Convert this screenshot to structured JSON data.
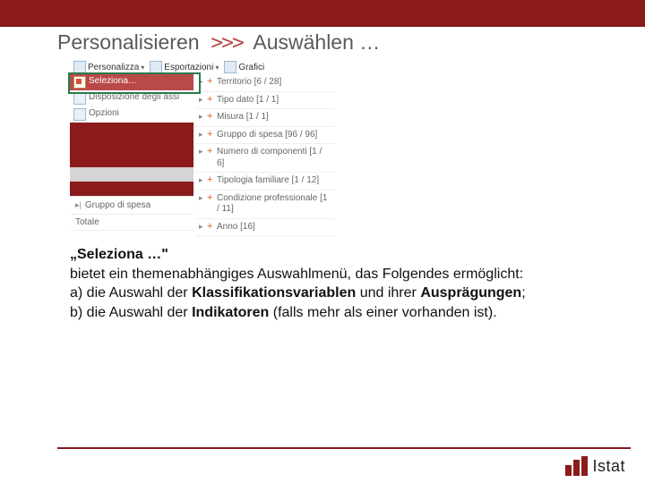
{
  "heading": {
    "left": "Personalisieren",
    "sep": ">>>",
    "right": "Auswählen …"
  },
  "toolbar": {
    "personalizza": "Personalizza",
    "esportazioni": "Esportazioni",
    "grafici": "Grafici"
  },
  "left_menu": {
    "seleziona": "Seleziona…",
    "disposizione": "Disposizione degli assi",
    "opzioni": "Opzioni"
  },
  "left_footer": {
    "gruppo": "Gruppo di spesa",
    "totale": "Totale"
  },
  "right_items": [
    "Territorio [6 / 28]",
    "Tipo dato [1 / 1]",
    "Misura [1 / 1]",
    "Gruppo di spesa [96 / 96]",
    "Numero di componenti [1 / 6]",
    "Tipologia familiare [1 / 12]",
    "Condizione professionale [1 / 11]",
    "Anno [16]"
  ],
  "desc": {
    "l1a": "„Seleziona …\"",
    "l2": "bietet ein themenabhängiges Auswahlmenü, das Folgendes ermöglicht:",
    "l3a": "a) die Auswahl der ",
    "l3b": "Klassifikationsvariablen",
    "l3c": " und ihrer ",
    "l3d": "Ausprägungen",
    "l3e": ";",
    "l4a": "b) die Auswahl der ",
    "l4b": "Indikatoren",
    "l4c": " (falls mehr als einer vorhanden ist)."
  },
  "logo": {
    "text": "Istat"
  }
}
